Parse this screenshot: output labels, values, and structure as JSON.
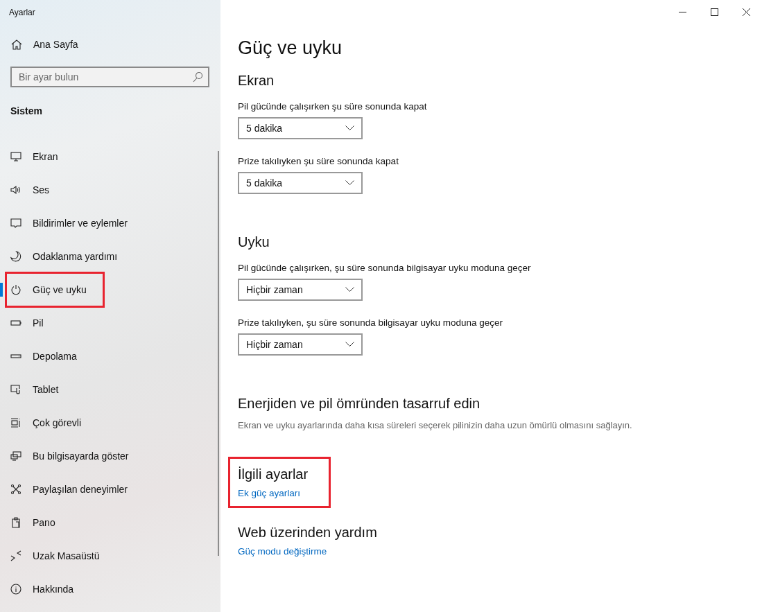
{
  "window": {
    "title": "Ayarlar"
  },
  "sidebar": {
    "home": "Ana Sayfa",
    "search": {
      "placeholder": "Bir ayar bulun"
    },
    "section": "Sistem",
    "items": [
      {
        "label": "Ekran",
        "selected": false,
        "annotated": false
      },
      {
        "label": "Ses",
        "selected": false,
        "annotated": false
      },
      {
        "label": "Bildirimler ve eylemler",
        "selected": false,
        "annotated": false
      },
      {
        "label": "Odaklanma yardımı",
        "selected": false,
        "annotated": false
      },
      {
        "label": "Güç ve uyku",
        "selected": true,
        "annotated": true
      },
      {
        "label": "Pil",
        "selected": false,
        "annotated": false
      },
      {
        "label": "Depolama",
        "selected": false,
        "annotated": false
      },
      {
        "label": "Tablet",
        "selected": false,
        "annotated": false
      },
      {
        "label": "Çok görevli",
        "selected": false,
        "annotated": false
      },
      {
        "label": "Bu bilgisayarda göster",
        "selected": false,
        "annotated": false
      },
      {
        "label": "Paylaşılan deneyimler",
        "selected": false,
        "annotated": false
      },
      {
        "label": "Pano",
        "selected": false,
        "annotated": false
      },
      {
        "label": "Uzak Masaüstü",
        "selected": false,
        "annotated": false
      },
      {
        "label": "Hakkında",
        "selected": false,
        "annotated": false
      }
    ]
  },
  "page": {
    "title": "Güç ve uyku",
    "sections": [
      {
        "heading": "Ekran",
        "annotated": false,
        "settings": [
          {
            "label": "Pil gücünde çalışırken şu süre sonunda kapat",
            "value": "5 dakika"
          },
          {
            "label": "Prize takılıyken şu süre sonunda kapat",
            "value": "5 dakika"
          }
        ]
      },
      {
        "heading": "Uyku",
        "annotated": false,
        "settings": [
          {
            "label": "Pil gücünde çalışırken, şu süre sonunda bilgisayar uyku moduna geçer",
            "value": "Hiçbir zaman"
          },
          {
            "label": "Prize takılıyken, şu süre sonunda bilgisayar uyku moduna geçer",
            "value": "Hiçbir zaman"
          }
        ]
      },
      {
        "heading": "Enerjiden ve pil ömründen tasarruf edin",
        "annotated": false,
        "description": "Ekran ve uyku ayarlarında daha kısa süreleri seçerek pilinizin daha uzun ömürlü olmasını sağlayın."
      },
      {
        "heading": "İlgili ayarlar",
        "annotated": true,
        "links": [
          "Ek güç ayarları"
        ]
      },
      {
        "heading": "Web üzerinden yardım",
        "annotated": false,
        "links": [
          "Güç modu değiştirme"
        ]
      }
    ]
  }
}
